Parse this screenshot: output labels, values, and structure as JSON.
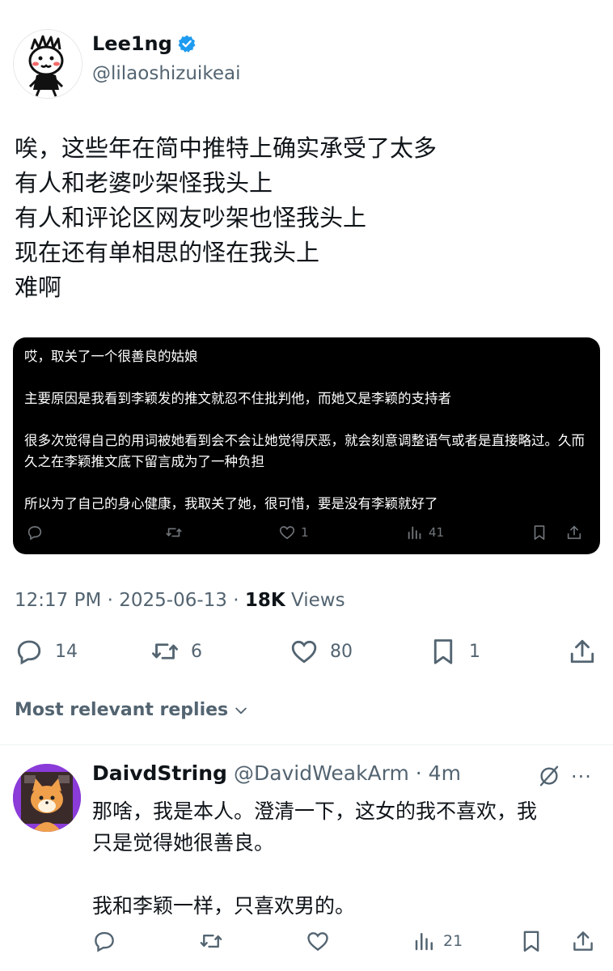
{
  "author": {
    "name": "Lee1ng",
    "handle": "@lilaoshizuikeai",
    "verified": true,
    "verified_color": "#1d9bf0"
  },
  "tweet": {
    "lines": [
      "唉，这些年在简中推特上确实承受了太多",
      "有人和老婆吵架怪我头上",
      "有人和评论区网友吵架也怪我头上",
      "现在还有单相思的怪在我头上",
      "难啊"
    ]
  },
  "embed": {
    "paragraphs": [
      "哎，取关了一个很善良的姑娘",
      "主要原因是我看到李颖发的推文就忍不住批判他，而她又是李颖的支持者",
      "很多次觉得自己的用词被她看到会不会让她觉得厌恶，就会刻意调整语气或者是直接略过。久而久之在李颖推文底下留言成为了一种负担",
      "所以为了自己的身心健康，我取关了她，很可惜，要是没有李颖就好了"
    ],
    "actions": {
      "reply_icon": "reply-icon",
      "retweet_icon": "retweet-icon",
      "like_icon": "heart-icon",
      "like_count": "1",
      "views_icon": "views-icon",
      "views_count": "41",
      "bookmark_icon": "bookmark-icon",
      "share_icon": "share-icon"
    }
  },
  "meta": {
    "time": "12:17 PM",
    "sep": "·",
    "date": "2025-06-13",
    "views_count": "18K",
    "views_label": "Views"
  },
  "actions": {
    "reply_count": "14",
    "retweet_count": "6",
    "like_count": "80",
    "bookmark_count": "1"
  },
  "replies_filter": {
    "label": "Most relevant replies"
  },
  "reply": {
    "name": "DaivdString",
    "handle_time": "@DavidWeakArm · 4m",
    "lines": [
      "那啥，我是本人。澄清一下，这女的我不喜欢，我",
      "只是觉得她很善良。",
      "",
      "我和李颖一样，只喜欢男的。"
    ],
    "views_count": "21",
    "more_label": "···"
  },
  "colors": {
    "text": "#0f1419",
    "secondary": "#536471",
    "embed_bg": "#000000",
    "embed_secondary": "#71767b"
  }
}
